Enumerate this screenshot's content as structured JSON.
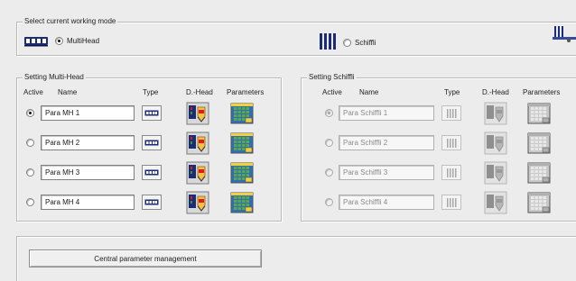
{
  "mode_group": {
    "title": "Select current working mode",
    "multihead_label": "MultiHead",
    "multihead_selected": true,
    "schiffli_label": "Schiffli",
    "schiffli_selected": false
  },
  "multihead_group": {
    "title": "Setting Multi-Head",
    "columns": {
      "active": "Active",
      "name": "Name",
      "type": "Type",
      "dhead": "D.-Head",
      "parameters": "Parameters"
    },
    "rows": [
      {
        "name": "Para MH 1",
        "active": true
      },
      {
        "name": "Para MH 2",
        "active": false
      },
      {
        "name": "Para MH 3",
        "active": false
      },
      {
        "name": "Para MH 4",
        "active": false
      }
    ]
  },
  "schiffli_group": {
    "title": "Setting Schiffli",
    "columns": {
      "active": "Active",
      "name": "Name",
      "type": "Type",
      "dhead": "D.-Head",
      "parameters": "Parameters"
    },
    "rows": [
      {
        "name": "Para Schiffli 1",
        "active": true
      },
      {
        "name": "Para Schiffli 2",
        "active": false
      },
      {
        "name": "Para Schiffli 3",
        "active": false
      },
      {
        "name": "Para Schiffli 4",
        "active": false
      }
    ]
  },
  "central_button_label": "Central parameter management",
  "colors": {
    "background": "#ececec",
    "multihead_icon": "#1c2b78",
    "disabled_text": "#8a8a8a"
  },
  "icons": {
    "multihead": "multihead-machine-icon",
    "schiffli": "schiffli-machine-icon",
    "dhead": "dhead-editor-icon",
    "parameters": "parameters-grid-icon"
  }
}
